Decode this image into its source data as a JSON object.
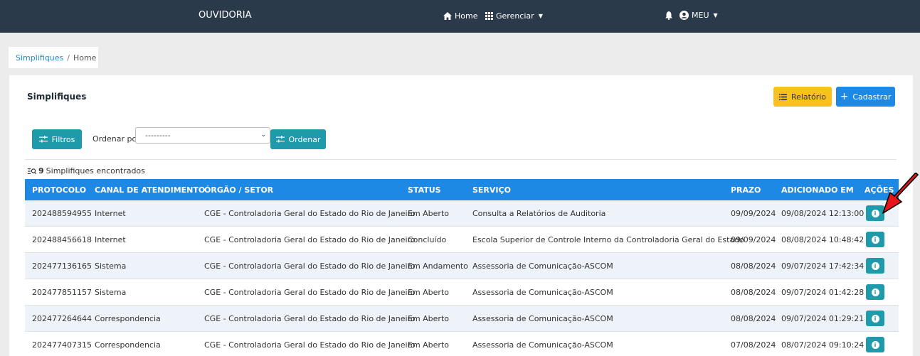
{
  "navbar": {
    "title": "OUVIDORIA",
    "home_label": "Home",
    "manage_label": "Gerenciar",
    "user_label": "MEU"
  },
  "breadcrumb": {
    "link": "Simplifiques",
    "separator": "/",
    "current": "Home"
  },
  "card": {
    "title": "Simplifiques",
    "report_button": "Relatório",
    "add_button": "Cadastrar",
    "filter_button": "Filtros",
    "order_label": "Ordenar por",
    "order_value": "---------",
    "order_button": "Ordenar",
    "count": "9",
    "count_text": "Simplifiques encontrados"
  },
  "table": {
    "headers": [
      "PROTOCOLO",
      "CANAL DE ATENDIMENTO",
      "ÓRGÃO / SETOR",
      "STATUS",
      "SERVIÇO",
      "PRAZO",
      "ADICIONADO EM",
      "AÇÕES"
    ],
    "rows": [
      {
        "protocolo": "202488594955",
        "canal": "Internet",
        "orgao": "CGE - Controladoria Geral do Estado do Rio de Janeiro",
        "status": "Em Aberto",
        "servico": "Consulta a Relatórios de Auditoria",
        "prazo": "09/09/2024",
        "adicionado": "09/08/2024 12:13:00"
      },
      {
        "protocolo": "202488456618",
        "canal": "Internet",
        "orgao": "CGE - Controladoria Geral do Estado do Rio de Janeiro",
        "status": "Concluído",
        "servico": "Escola Superior de Controle Interno da Controladoria Geral do Estado",
        "prazo": "09/09/2024",
        "adicionado": "08/08/2024 10:48:42"
      },
      {
        "protocolo": "202477136165",
        "canal": "Sistema",
        "orgao": "CGE - Controladoria Geral do Estado do Rio de Janeiro",
        "status": "Em Andamento",
        "servico": "Assessoria de Comunicação-ASCOM",
        "prazo": "08/08/2024",
        "adicionado": "09/07/2024 17:42:34"
      },
      {
        "protocolo": "202477851157",
        "canal": "Sistema",
        "orgao": "CGE - Controladoria Geral do Estado do Rio de Janeiro",
        "status": "Em Aberto",
        "servico": "Assessoria de Comunicação-ASCOM",
        "prazo": "08/08/2024",
        "adicionado": "09/07/2024 01:42:28"
      },
      {
        "protocolo": "202477264644",
        "canal": "Correspondencia",
        "orgao": "CGE - Controladoria Geral do Estado do Rio de Janeiro",
        "status": "Em Aberto",
        "servico": "Assessoria de Comunicação-ASCOM",
        "prazo": "08/08/2024",
        "adicionado": "09/07/2024 01:29:21"
      },
      {
        "protocolo": "202477407315",
        "canal": "Correspondencia",
        "orgao": "CGE - Controladoria Geral do Estado do Rio de Janeiro",
        "status": "Em Aberto",
        "servico": "Assessoria de Comunicação-ASCOM",
        "prazo": "07/08/2024",
        "adicionado": "08/07/2024 09:10:24"
      }
    ]
  },
  "colors": {
    "navbar": "#2b3a4a",
    "primary": "#1e88e5",
    "teal": "#1e9aaa",
    "warning": "#f8c21a",
    "annotation_arrow": "#e8141c"
  }
}
